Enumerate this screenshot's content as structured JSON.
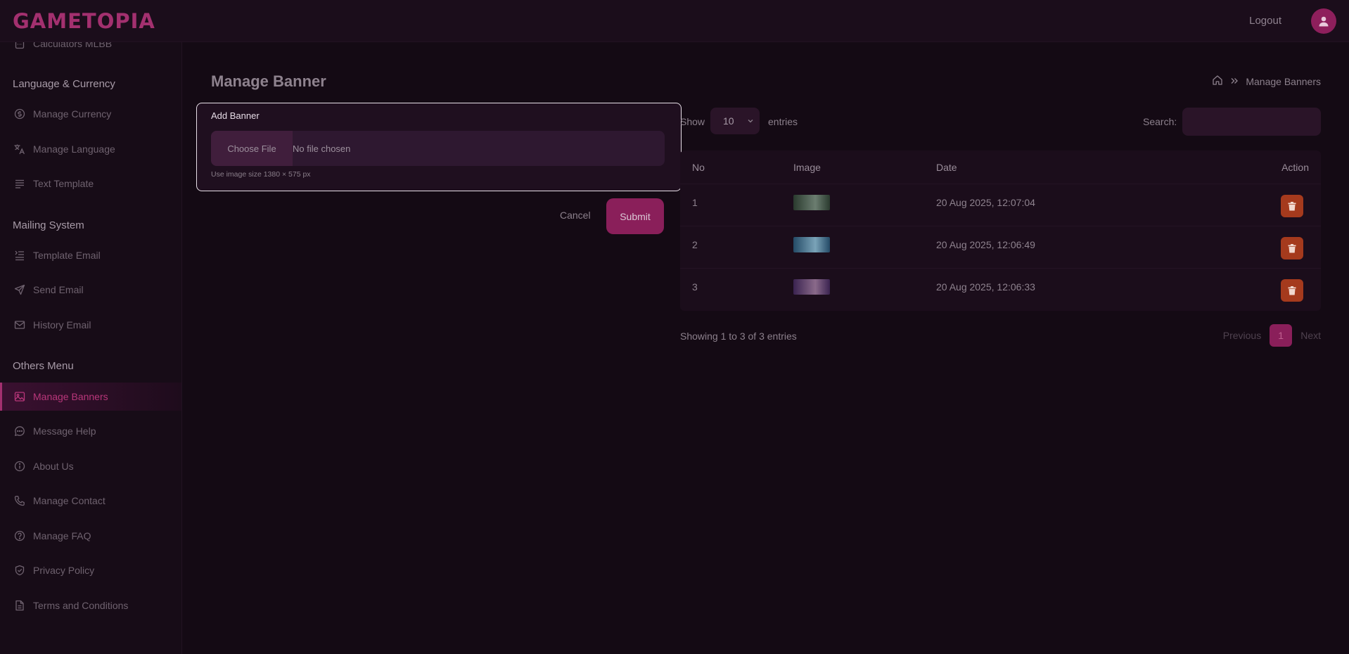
{
  "app": {
    "logo": "GAMETOPIA"
  },
  "header": {
    "logout_label": "Logout",
    "avatar_icon": "user-icon"
  },
  "sidebar": {
    "partial_item": {
      "label": "Calculators MLBB",
      "icon": "calculator-icon"
    },
    "sections": [
      {
        "title": "Language & Currency",
        "items": [
          {
            "label": "Manage Currency",
            "icon": "dollar-circle-icon"
          },
          {
            "label": "Manage Language",
            "icon": "translate-icon"
          },
          {
            "label": "Text Template",
            "icon": "text-lines-icon"
          }
        ]
      },
      {
        "title": "Mailing System",
        "items": [
          {
            "label": "Template Email",
            "icon": "list-indent-icon"
          },
          {
            "label": "Send Email",
            "icon": "send-icon"
          },
          {
            "label": "History Email",
            "icon": "mail-icon"
          }
        ]
      },
      {
        "title": "Others Menu",
        "items": [
          {
            "label": "Manage Banners",
            "icon": "image-icon",
            "active": true
          },
          {
            "label": "Message Help",
            "icon": "chat-icon"
          },
          {
            "label": "About Us",
            "icon": "info-icon"
          },
          {
            "label": "Manage Contact",
            "icon": "phone-icon"
          },
          {
            "label": "Manage FAQ",
            "icon": "question-icon"
          },
          {
            "label": "Privacy Policy",
            "icon": "shield-icon"
          },
          {
            "label": "Terms and Conditions",
            "icon": "document-icon"
          }
        ]
      }
    ]
  },
  "main": {
    "title": "Manage Banner",
    "breadcrumb": {
      "home_icon": "home-icon",
      "separator_icon": "double-chevron-icon",
      "current": "Manage Banners"
    },
    "form": {
      "title": "Add Banner",
      "file_button": "Choose File",
      "file_status": "No file chosen",
      "hint": "Use image size 1380 × 575 px",
      "cancel_label": "Cancel",
      "submit_label": "Submit"
    },
    "table": {
      "show_label": "Show",
      "page_length": "10",
      "entries_label": "entries",
      "search_label": "Search:",
      "search_value": "",
      "columns": [
        "No",
        "Image",
        "Date",
        "Action"
      ],
      "rows": [
        {
          "no": "1",
          "date": "20 Aug 2025, 12:07:04",
          "thumb_colors": [
            "#2a3a2e",
            "#6b7d70"
          ]
        },
        {
          "no": "2",
          "date": "20 Aug 2025, 12:06:49",
          "thumb_colors": [
            "#244a66",
            "#7aa3b8"
          ]
        },
        {
          "no": "3",
          "date": "20 Aug 2025, 12:06:33",
          "thumb_colors": [
            "#3a2350",
            "#8a6a8a"
          ]
        }
      ],
      "delete_icon": "trash-icon",
      "info": "Showing 1 to 3 of 3 entries",
      "pagination": {
        "previous": "Previous",
        "current": "1",
        "next": "Next"
      }
    }
  },
  "colors": {
    "accent": "#8a1f5a",
    "active_text": "#b8367a",
    "danger": "#a53a1d",
    "background": "#140a14"
  }
}
